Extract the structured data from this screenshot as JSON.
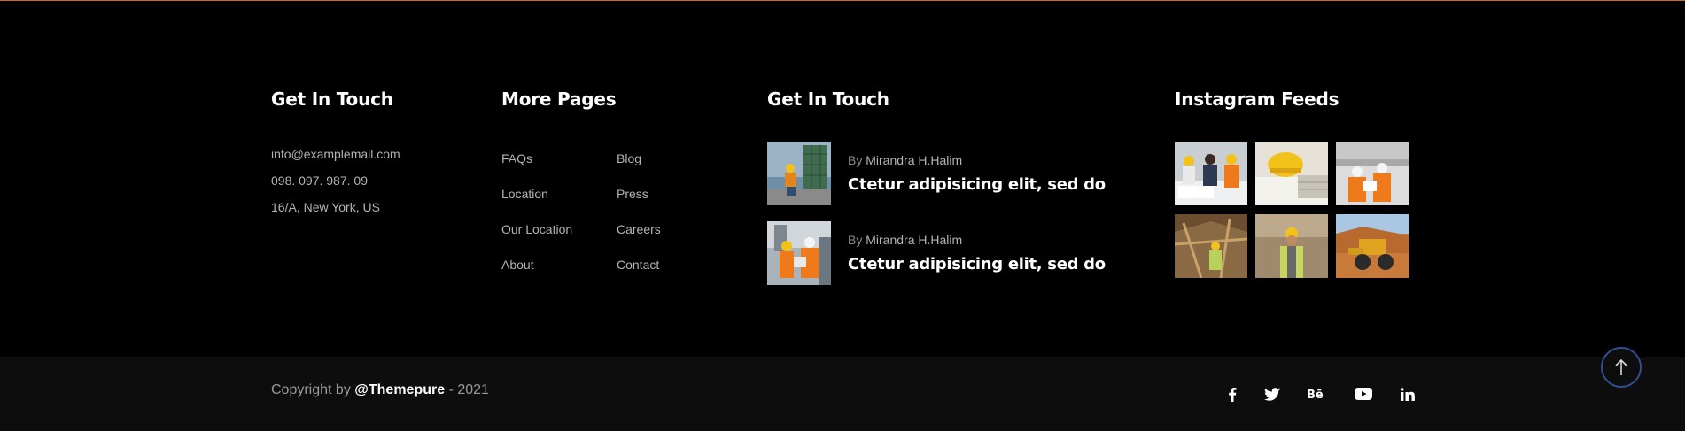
{
  "col1": {
    "title": "Get In Touch",
    "email": "info@examplemail.com",
    "phone": "098. 097. 987. 09",
    "address": "16/A, New York, US"
  },
  "col2": {
    "title": "More Pages",
    "left_links": [
      "FAQs",
      "Location",
      "Our Location",
      "About"
    ],
    "right_links": [
      "Blog",
      "Press",
      "Careers",
      "Contact"
    ]
  },
  "col3": {
    "title": "Get In Touch",
    "posts": [
      {
        "by": "By",
        "author": "Mirandra H.Halim",
        "title": "Ctetur adipisicing elit, sed do"
      },
      {
        "by": "By",
        "author": "Mirandra H.Halim",
        "title": "Ctetur adipisicing elit, sed do"
      }
    ]
  },
  "col4": {
    "title": "Instagram Feeds"
  },
  "bottom": {
    "copyright_prefix": "Copyright by",
    "brand": "@Themepure",
    "copyright_suffix": "- 2021"
  },
  "social_icons": [
    "facebook-icon",
    "twitter-icon",
    "behance-icon",
    "youtube-icon",
    "linkedin-icon"
  ],
  "colors": {
    "accent_line": "#c46a1e",
    "scroll_top_border": "#2f4d8f",
    "background": "#000000",
    "bottom_bar": "#0d0d0d"
  }
}
